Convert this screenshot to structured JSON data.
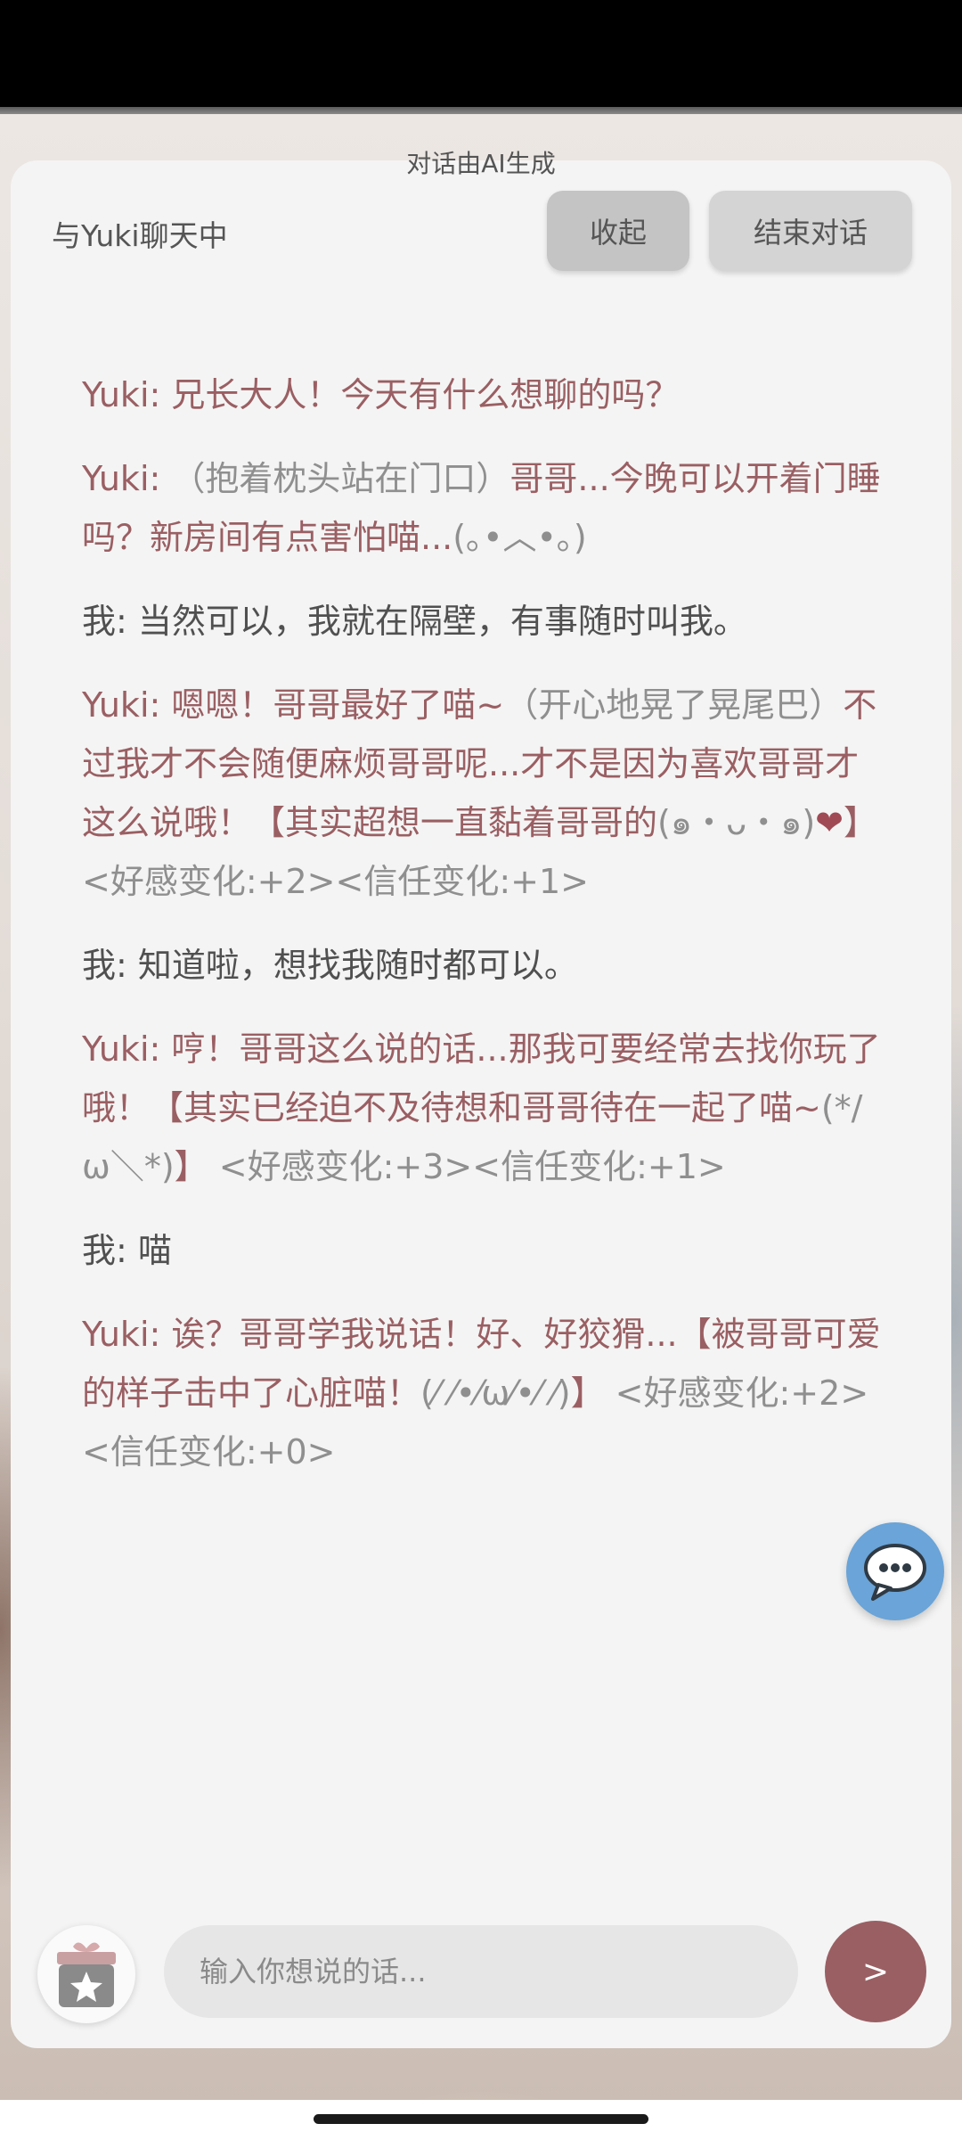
{
  "header": {
    "ai_note": "对话由AI生成",
    "title": "与Yuki聊天中",
    "collapse_label": "收起",
    "end_label": "结束对话"
  },
  "messages": [
    {
      "role": "yuki",
      "speaker": "Yuki: ",
      "parts": [
        {
          "kind": "spoken",
          "text": "兄长大人！今天有什么想聊的吗？"
        }
      ]
    },
    {
      "role": "yuki",
      "speaker": "Yuki: ",
      "parts": [
        {
          "kind": "action",
          "text": "（抱着枕头站在门口）"
        },
        {
          "kind": "spoken",
          "text": "哥哥...今晚可以开着门睡吗？新房间有点害怕喵..."
        },
        {
          "kind": "action",
          "text": "(｡•︿•｡)"
        }
      ]
    },
    {
      "role": "me",
      "speaker": "我: ",
      "parts": [
        {
          "kind": "spoken",
          "text": "当然可以，我就在隔壁，有事随时叫我。"
        }
      ]
    },
    {
      "role": "yuki",
      "speaker": "Yuki: ",
      "parts": [
        {
          "kind": "spoken",
          "text": "嗯嗯！哥哥最好了喵~"
        },
        {
          "kind": "action",
          "text": "（开心地晃了晃尾巴）"
        },
        {
          "kind": "spoken",
          "text": "不过我才不会随便麻烦哥哥呢...才不是因为喜欢哥哥才这么说哦！【其实超想一直黏着哥哥的"
        },
        {
          "kind": "action",
          "text": "(๑・ᴗ・๑)"
        },
        {
          "kind": "heart",
          "text": "❤"
        },
        {
          "kind": "spoken",
          "text": "】"
        },
        {
          "kind": "tag",
          "text": " <好感变化:+2><信任变化:+1>"
        }
      ]
    },
    {
      "role": "me",
      "speaker": "我: ",
      "parts": [
        {
          "kind": "spoken",
          "text": "知道啦，想找我随时都可以。"
        }
      ]
    },
    {
      "role": "yuki",
      "speaker": "Yuki: ",
      "parts": [
        {
          "kind": "spoken",
          "text": "哼！哥哥这么说的话...那我可要经常去找你玩了哦！【其实已经迫不及待想和哥哥待在一起了喵~"
        },
        {
          "kind": "action",
          "text": "(*/ω＼*)"
        },
        {
          "kind": "spoken",
          "text": "】"
        },
        {
          "kind": "tag",
          "text": " <好感变化:+3><信任变化:+1>"
        }
      ]
    },
    {
      "role": "me",
      "speaker": "我: ",
      "parts": [
        {
          "kind": "spoken",
          "text": "喵"
        }
      ]
    },
    {
      "role": "yuki",
      "speaker": "Yuki: ",
      "parts": [
        {
          "kind": "spoken",
          "text": "诶？哥哥学我说话！好、好狡猾...【被哥哥可爱的样子击中了心脏喵！"
        },
        {
          "kind": "action",
          "text": "(⁄ ⁄•⁄ω⁄•⁄ ⁄)"
        },
        {
          "kind": "spoken",
          "text": "】"
        },
        {
          "kind": "tag",
          "text": " <好感变化:+2><信任变化:+0>"
        }
      ]
    }
  ],
  "input": {
    "placeholder": "输入你想说的话...",
    "value": ""
  },
  "send_label": ">",
  "icons": {
    "chat_fab": "chat-bubble-icon",
    "gift": "gift-star-icon"
  },
  "colors": {
    "accent": "#9a5f63",
    "fab": "#6aa4d8",
    "panel": "#f4f4f4"
  }
}
